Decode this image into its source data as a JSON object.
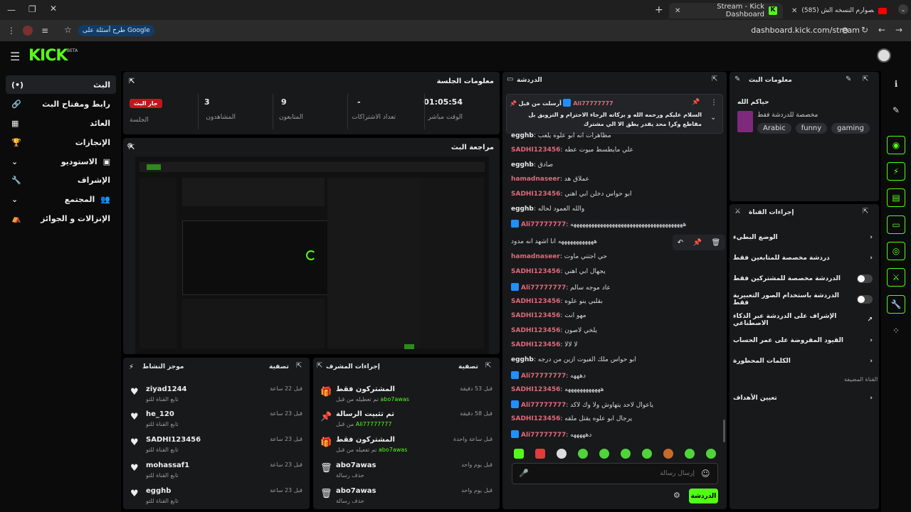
{
  "browser": {
    "tab1_title": "(585) صليل الصوارم النسخه الش...",
    "tab2_title": "Stream - Kick Dashboard",
    "url": "dashboard.kick.com/stream",
    "google_chip": "طرح أسئلة على Google"
  },
  "header": {
    "logo": "KICK",
    "beta": "BETA"
  },
  "sidebar": {
    "items": [
      {
        "label": "البث"
      },
      {
        "label": "رابط ومفتاح البث"
      },
      {
        "label": "العائد"
      },
      {
        "label": "الإنجازات"
      },
      {
        "label": "الاستوديو"
      },
      {
        "label": "الإشراف"
      },
      {
        "label": "المجتمع"
      },
      {
        "label": "الإنزالات و الجوائز"
      }
    ]
  },
  "session": {
    "title": "معلومات الجلسة",
    "stats": [
      {
        "value": "01:05:54",
        "label": "الوقت مباشر"
      },
      {
        "value": "-",
        "label": "تعداد الاشتراكات"
      },
      {
        "value": "9",
        "label": "المتابعون"
      },
      {
        "value": "3",
        "label": "المشاهدون"
      }
    ],
    "live_badge": "جار البث",
    "live_label": "الجلسة"
  },
  "preview": {
    "title": "مراجعة البث"
  },
  "activity": {
    "title": "موجز النشاط",
    "filter": "تصفية",
    "items": [
      {
        "name": "ziyad1244",
        "sub": "تابع القناة للتو",
        "time": "قبل 22 ساعة"
      },
      {
        "name": "he_120",
        "sub": "تابع القناة للتو",
        "time": "قبل 23 ساعة"
      },
      {
        "name": "SADHI123456",
        "sub": "تابع القناة للتو",
        "time": "قبل 23 ساعة"
      },
      {
        "name": "mohassaf1",
        "sub": "تابع القناة للتو",
        "time": "قبل 23 ساعة"
      },
      {
        "name": "egghb",
        "sub": "تابع القناة للتو",
        "time": "قبل 23 ساعة"
      }
    ]
  },
  "modactions": {
    "title": "إجراءات المشرف",
    "filter": "تصفية",
    "items": [
      {
        "name": "المشتركون فقط",
        "sub": "تم تعطيله من قبل",
        "actor": "abo7awas",
        "time": "قبل 53 دقيقة"
      },
      {
        "name": "تم تثبيت الرسالة",
        "sub": "من قبل",
        "actor": "Ali77777777",
        "time": "قبل 58 دقيقة"
      },
      {
        "name": "المشتركون فقط",
        "sub": "تم تفعيله من قبل",
        "actor": "abo7awas",
        "time": "قبل ساعة واحدة"
      },
      {
        "name": "abo7awas",
        "sub": "حذف رسالة",
        "actor": "",
        "time": "قبل يوم واحد"
      },
      {
        "name": "abo7awas",
        "sub": "حذف رسالة",
        "actor": "",
        "time": "قبل يوم واحد"
      }
    ]
  },
  "chat": {
    "title": "الدردشة",
    "pinned_by": "أرسلت من قبل",
    "pinned_user": "Ali77777777",
    "pinned_text": "السلام عليكم ورحمه الله و بركاته الرجاء الاحترام و التزويق بل مقاطع وكرا محد يقدر يطق الا الي مشترك",
    "messages": [
      {
        "user": "egghb",
        "text": "مظاهرات انه ابو علوه يلعب",
        "color": "g",
        "badge": false
      },
      {
        "user": "SADHI123456",
        "text": "علي مايطسط ميوت عطه",
        "color": "r",
        "badge": false
      },
      {
        "user": "egghb",
        "text": "صادق",
        "color": "g",
        "badge": false
      },
      {
        "user": "hamadnaseer",
        "text": "عملاق هد",
        "color": "r",
        "badge": false
      },
      {
        "user": "SADHI123456",
        "text": "ابو حواس دخلن ابي اهني",
        "color": "r",
        "badge": false
      },
      {
        "user": "egghb",
        "text": "والله العمود لحاله",
        "color": "g",
        "badge": false
      },
      {
        "user": "Ali77777777",
        "text": "ههههههههههههههههههههههههههههههههههههههه",
        "color": "r",
        "badge": true
      },
      {
        "user": "",
        "text": "ههههههههههههه انا اشهد انه مدود",
        "color": "g",
        "badge": false
      },
      {
        "user": "hamadnaseer",
        "text": "حي اجتني ماوت",
        "color": "r",
        "badge": false
      },
      {
        "user": "SADHI123456",
        "text": "يجهال ابي اهني",
        "color": "r",
        "badge": false
      },
      {
        "user": "Ali77777777",
        "text": "عاد موجه سالم",
        "color": "r",
        "badge": true
      },
      {
        "user": "SADHI123456",
        "text": "بقلبي ينو علوه",
        "color": "r",
        "badge": false
      },
      {
        "user": "SADHI123456",
        "text": "مهو انت",
        "color": "r",
        "badge": false
      },
      {
        "user": "SADHI123456",
        "text": "يلخي لاصون",
        "color": "r",
        "badge": false
      },
      {
        "user": "SADHI123456",
        "text": "لا لالا",
        "color": "r",
        "badge": false
      },
      {
        "user": "egghb",
        "text": "ابو حواس ملك الفيوت ازين من درجه",
        "color": "g",
        "badge": false
      },
      {
        "user": "Ali77777777",
        "text": "دهههه",
        "color": "r",
        "badge": true
      },
      {
        "user": "SADHI123456",
        "text": "ههههههههههههه",
        "color": "r",
        "badge": false
      },
      {
        "user": "Ali77777777",
        "text": "ياعوال لاحد يتهاوش ولا وك لاكد",
        "color": "r",
        "badge": true
      },
      {
        "user": "SADHI123456",
        "text": "يرجال ابو علوه يقتل ملقه",
        "color": "r",
        "badge": false
      },
      {
        "user": "Ali77777777",
        "text": "دهههههه",
        "color": "r",
        "badge": true
      }
    ],
    "input_placeholder": "إرسال رسالة",
    "send_label": "الدردشة"
  },
  "stream_info": {
    "title": "معلومات البث",
    "stream_title": "حياكم الله",
    "category": "مخصصة للدردشة فقط",
    "tags": [
      "Arabic",
      "funny",
      "gaming"
    ]
  },
  "channel_actions": {
    "title": "إجراءات القناة",
    "rows": [
      {
        "label": "الوضع البطيء",
        "control": "chevron"
      },
      {
        "label": "دردشة مخصصة للمتابعين فقط",
        "control": "chevron"
      },
      {
        "label": "الدردشة مخصصة للمشتركين فقط",
        "control": "toggle"
      },
      {
        "label": "الدردشة باستخدام الصور التعبيرية فقط",
        "control": "toggle"
      },
      {
        "label": "الإشراف على الدردشة عبر الذكاء الاصطناعي",
        "control": "external"
      },
      {
        "label": "القيود المفروضة على عمر الحساب",
        "control": "chevron"
      },
      {
        "label": "الكلمات المحظورة",
        "control": "chevron"
      }
    ],
    "hosted_label": "القناة المضيفة",
    "goals_label": "تعيين الأهداف"
  },
  "colors": {
    "accent": "#53fc18",
    "panel": "#18191b",
    "live": "#c2161c",
    "username_red": "#e06a7a"
  }
}
